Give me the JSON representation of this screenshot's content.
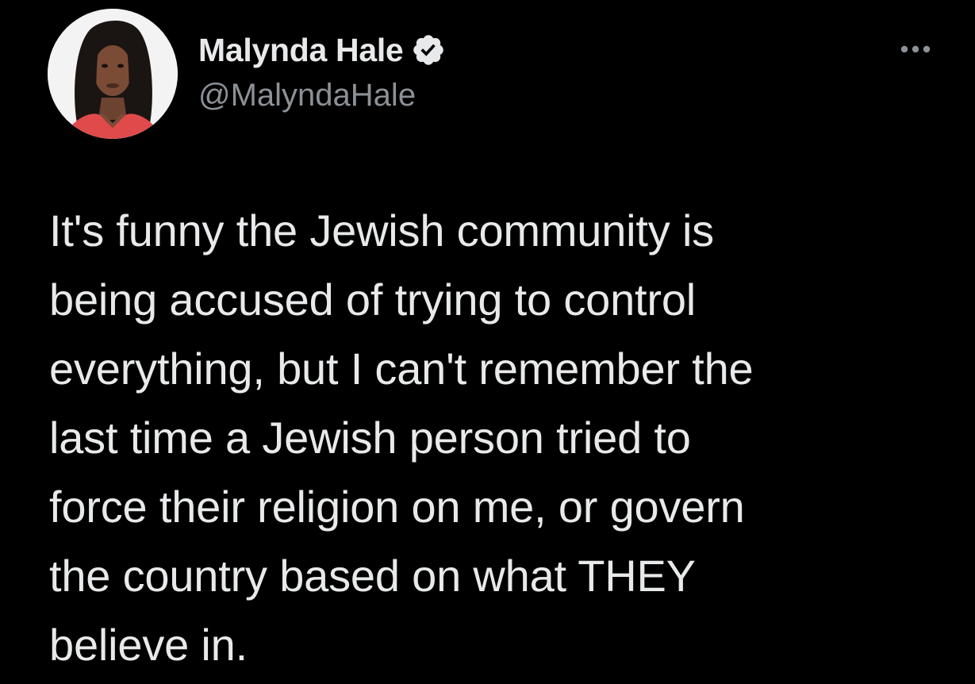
{
  "tweet": {
    "author": {
      "display_name": "Malynda Hale",
      "handle": "@MalyndaHale",
      "verified": true,
      "avatar_icon": "profile-photo"
    },
    "more_icon": "more-options-icon",
    "text_lines": [
      "It's funny the Jewish community is",
      "being accused of trying to control",
      "everything, but I can't remember the",
      "last time a Jewish person tried to",
      "force their religion on me, or govern",
      "the country based on what THEY",
      "believe in."
    ]
  },
  "colors": {
    "background": "#000000",
    "text_primary": "#e7e9ea",
    "text_secondary": "#8b9196"
  }
}
